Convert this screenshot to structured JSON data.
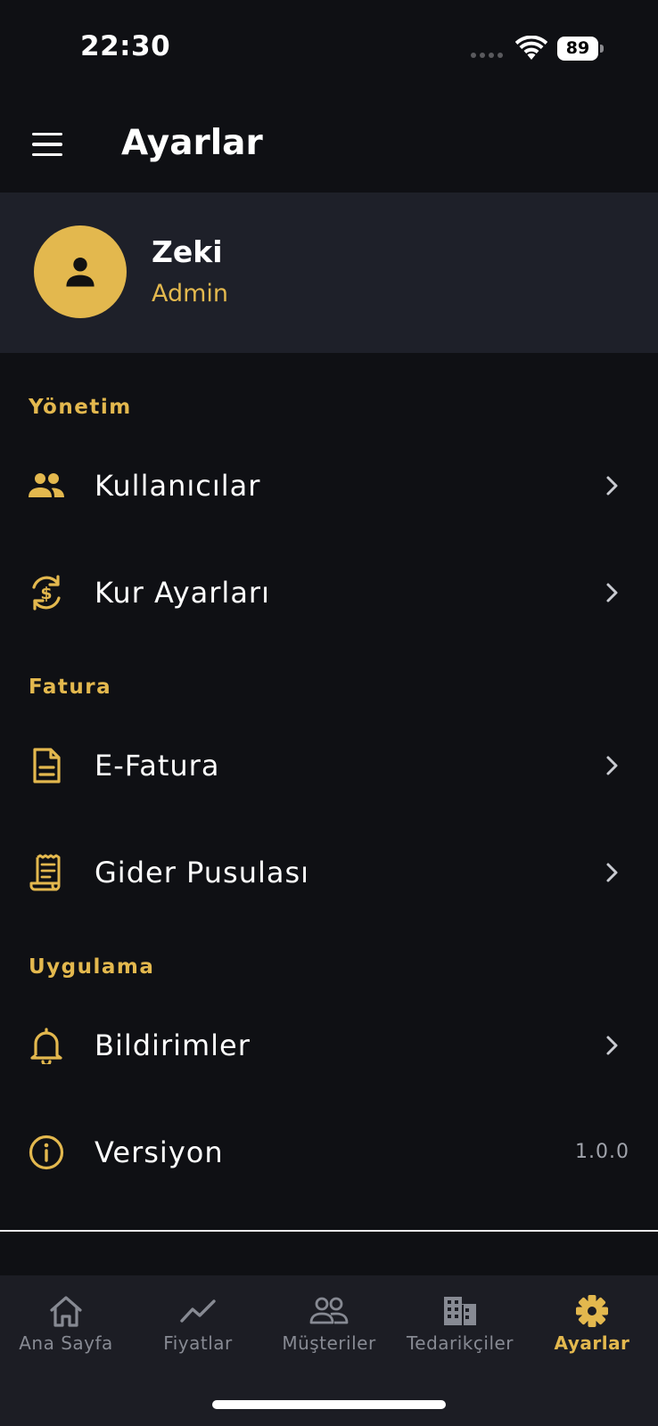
{
  "status_bar": {
    "time": "22:30",
    "battery": "89"
  },
  "header": {
    "title": "Ayarlar"
  },
  "profile": {
    "name": "Zeki",
    "role": "Admin"
  },
  "sections": [
    {
      "title": "Yönetim",
      "items": [
        {
          "label": "Kullanıcılar",
          "icon": "users-icon"
        },
        {
          "label": "Kur Ayarları",
          "icon": "currency-exchange-icon"
        }
      ]
    },
    {
      "title": "Fatura",
      "items": [
        {
          "label": "E-Fatura",
          "icon": "document-icon"
        },
        {
          "label": "Gider Pusulası",
          "icon": "receipt-icon"
        }
      ]
    },
    {
      "title": "Uygulama",
      "items": [
        {
          "label": "Bildirimler",
          "icon": "bell-icon"
        },
        {
          "label": "Versiyon",
          "icon": "info-icon",
          "value": "1.0.0"
        }
      ]
    }
  ],
  "tabs": [
    {
      "label": "Ana Sayfa",
      "icon": "home-icon",
      "active": false
    },
    {
      "label": "Fiyatlar",
      "icon": "trending-up-icon",
      "active": false
    },
    {
      "label": "Müşteriler",
      "icon": "people-icon",
      "active": false
    },
    {
      "label": "Tedarikçiler",
      "icon": "building-icon",
      "active": false
    },
    {
      "label": "Ayarlar",
      "icon": "gear-icon",
      "active": true
    }
  ],
  "colors": {
    "accent": "#e3b84e",
    "background": "#0f1014",
    "card": "#1e2029",
    "tab_bar": "#1c1d24",
    "inactive": "#878a93"
  }
}
